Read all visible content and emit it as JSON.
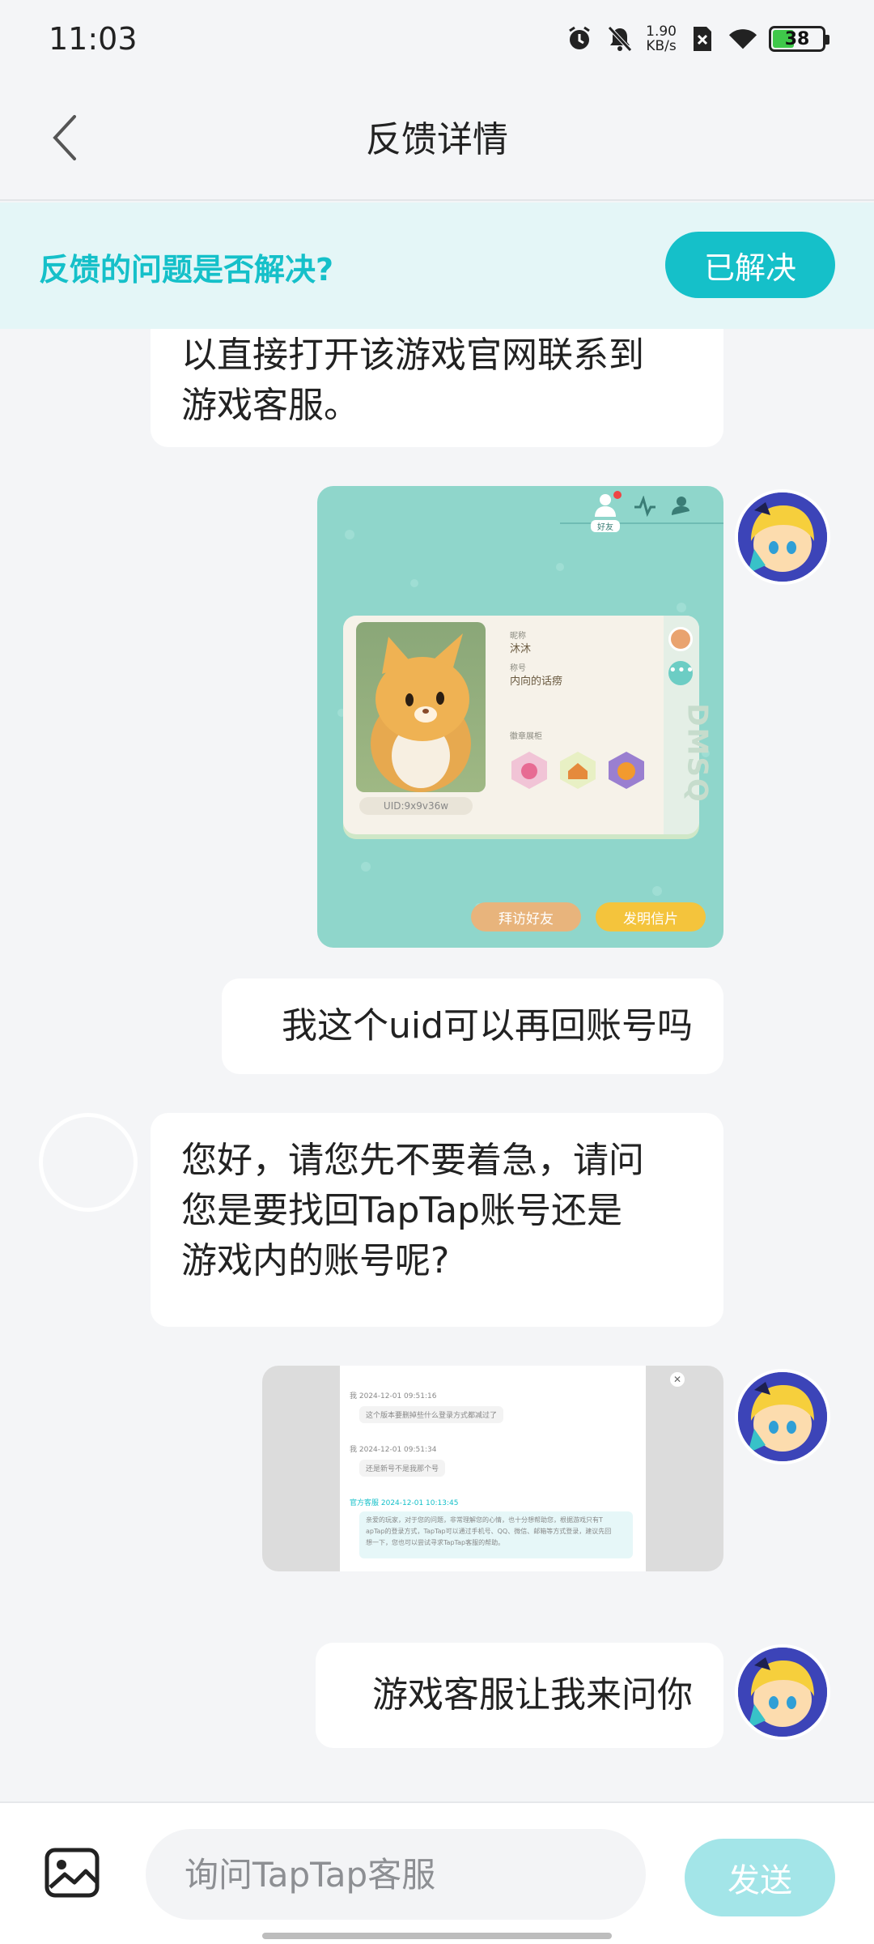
{
  "status": {
    "time": "11:03",
    "speed_value": "1.90",
    "speed_unit": "KB/s",
    "battery": "38"
  },
  "header": {
    "title": "反馈详情"
  },
  "banner": {
    "question": "反馈的问题是否解决?",
    "resolved_label": "已解决"
  },
  "messages": [
    {
      "from": "support",
      "text_line1": "以直接打开该游戏官网联系到",
      "text_line2": "游戏客服。"
    },
    {
      "from": "user",
      "type": "image",
      "game": {
        "nickname_label": "昵称",
        "nickname": "沐沐",
        "title_label": "称号",
        "title": "内向的话痨",
        "badge_label": "徽章展柜",
        "uid": "UID:9x9v36w",
        "btn_visit": "拜访好友",
        "btn_letter": "发明信片",
        "tab_friends": "好友",
        "side_text": "DMSQ"
      }
    },
    {
      "from": "user",
      "text": "我这个uid可以再回账号吗"
    },
    {
      "from": "support",
      "text_line1": "您好，请您先不要着急，请问",
      "text_line2": "您是要找回TapTap账号还是",
      "text_line3": "游戏内的账号呢?"
    },
    {
      "from": "user",
      "type": "image",
      "shot": {
        "line1": "我 2024-12-01 09:51:16",
        "line2": "这个版本要删掉些什么登录方式都减过了",
        "line3": "我 2024-12-01 09:51:34",
        "line4": "还是新号不是我那个号",
        "line5": "官方客服 2024-12-01 10:13:45",
        "line6": "亲爱的玩家，对于您的问题，非常理解您的心情，也十分想帮助您，根据游戏只有T",
        "line7": "apTap的登录方式，TapTap可以通过手机号、QQ、微信、邮箱等方式登录，建议先回",
        "line8": "想一下，您也可以尝试寻求TapTap客服的帮助。"
      }
    },
    {
      "from": "user",
      "text": "游戏客服让我来问你"
    }
  ],
  "composer": {
    "placeholder": "询问TapTap客服",
    "send_label": "发送"
  },
  "colors": {
    "accent": "#15c0c9",
    "banner_bg": "#e4f6f7",
    "send_disabled": "#a3e5e8"
  }
}
